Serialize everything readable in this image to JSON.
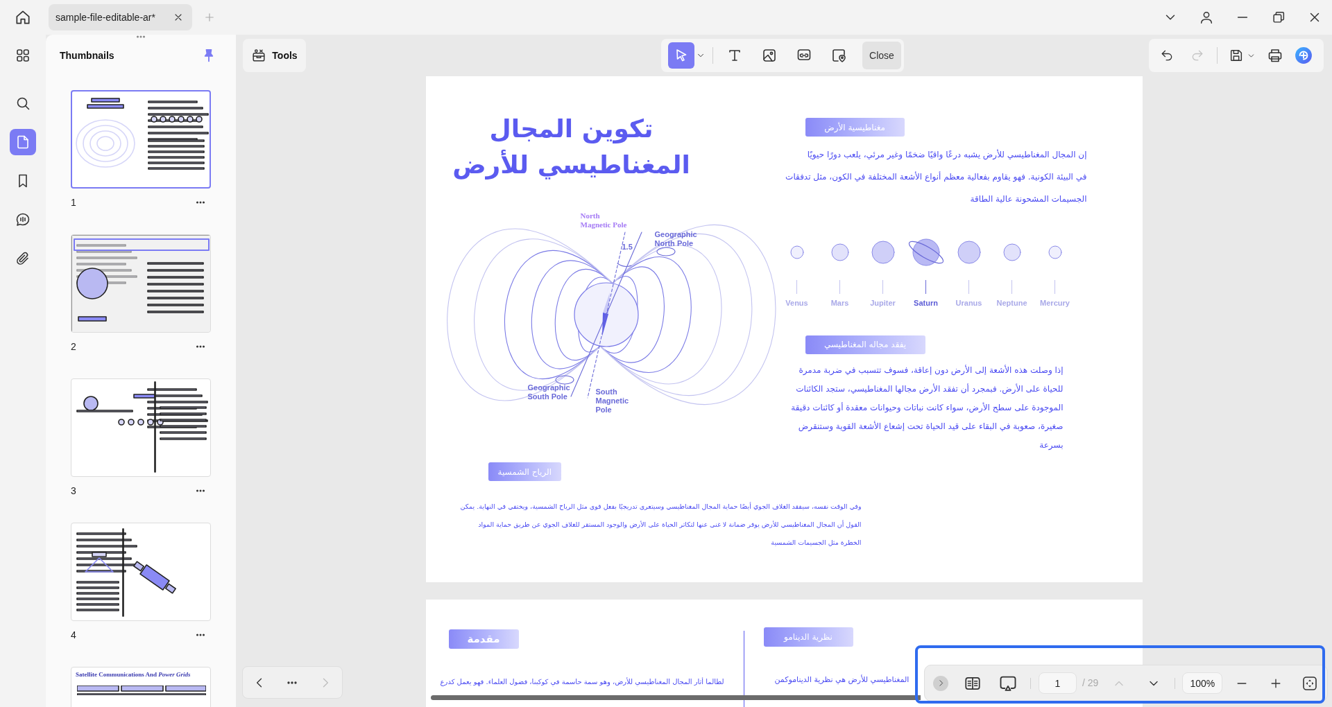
{
  "tabs": [
    {
      "label": "sample-file-editable-ar*",
      "selected": true
    }
  ],
  "rail": [
    {
      "kind": "apps",
      "selected": false
    },
    {
      "kind": "search",
      "selected": false
    },
    {
      "kind": "pages",
      "selected": true
    },
    {
      "kind": "bookmarks",
      "selected": false
    },
    {
      "kind": "comments",
      "selected": false
    },
    {
      "kind": "attachments",
      "selected": false
    }
  ],
  "thumbnails_panel": {
    "title": "Thumbnails",
    "pinned": true,
    "items": [
      {
        "page": "1",
        "selected": true
      },
      {
        "page": "2",
        "selected": false
      },
      {
        "page": "3",
        "selected": false
      },
      {
        "page": "4",
        "selected": false
      },
      {
        "heading": "Satellite Communications And *Power Grids*",
        "selected": false
      }
    ]
  },
  "tools_button": {
    "label": "Tools"
  },
  "edit_toolbar": {
    "tools": [
      {
        "kind": "select",
        "selected": true
      },
      {
        "kind": "text",
        "selected": false
      },
      {
        "kind": "image",
        "selected": false
      },
      {
        "kind": "link",
        "selected": false
      },
      {
        "kind": "stamp",
        "selected": false
      }
    ],
    "close_label": "Close"
  },
  "history": {
    "undo_disabled": false,
    "redo_disabled": true
  },
  "page_1": {
    "title_lines": [
      "تكوين المجال",
      "المغناطيسي للأرض"
    ],
    "sections": [
      {
        "heading": "مغناطيسية الأرض",
        "lines": [
          "إن المجال المغناطيسي للأرض يشبه درعًا واقيًا ضخمًا وغير مرئي، يلعب دورًا حيويًا",
          "في البيئة الكونية. فهو يقاوم بفعالية معظم أنواع الأشعة المختلفة في الكون، مثل تدفقات",
          "الجسيمات المشحونة عالية الطاقة"
        ]
      },
      {
        "heading": "يفقد مجاله المغناطيسي",
        "lines": [
          "إذا وصلت هذه الأشعة إلى الأرض دون إعاقة، فسوف تتسبب في ضربة مدمرة",
          "للحياة على الأرض. فبمجرد أن تفقد الأرض مجالها المغناطيسي، ستجد الكائنات",
          "الموجودة على سطح الأرض، سواء كانت نباتات وحيوانات معقدة أو كائنات دقيقة",
          "صغيرة، صعوبة في البقاء على قيد الحياة تحت إشعاع الأشعة القوية وستنقرض",
          "بسرعة"
        ]
      },
      {
        "heading": "الرياح الشمسية",
        "lines": [
          "وفي الوقت نفسه، سيفقد الغلاف الجوي أيضًا حماية المجال المغناطيسي وسيتعرى تدريجيًا بفعل قوى مثل الرياح الشمسية، ويختفي في النهاية. يمكن",
          "القول أن المجال المغناطيسي للأرض يوفر ضمانة لا غنى عنها لتكاثر الحياة على الأرض والوجود المستقر للغلاف الجوي عن طريق حماية المواد",
          "الخطرة مثل الجسيمات الشمسية"
        ]
      }
    ],
    "diagram_labels": [
      {
        "lines": [
          "North",
          "Magnetic Pole"
        ]
      },
      {
        "lines": [
          "Geographic",
          "North Pole"
        ]
      },
      {
        "lines": [
          "1.5"
        ]
      },
      {
        "lines": [
          "Geographic",
          "South Pole"
        ]
      },
      {
        "lines": [
          "South",
          "Magnetic",
          "Pole"
        ]
      }
    ],
    "planets": [
      {
        "name": "Mercury",
        "kind": "plain"
      },
      {
        "name": "Neptune",
        "kind": "plain"
      },
      {
        "name": "Uranus",
        "kind": "plain"
      },
      {
        "name": "Saturn",
        "kind": "ringed"
      },
      {
        "name": "Jupiter",
        "kind": "plain"
      },
      {
        "name": "Mars",
        "kind": "plain"
      },
      {
        "name": "Venus",
        "kind": "plain"
      }
    ]
  },
  "page_2": {
    "sections": [
      {
        "heading": "نظرية الدينامو",
        "lines": [
          "المغناطيسي للأرض هي نظرية الديناموكمن"
        ]
      },
      {
        "heading": "مقدمة",
        "lines": [
          "لطالما أثار المجال المغناطيسي للأرض، وهو سمة حاسمة في كوكبنا، فضول العلماء. فهو يعمل كدرع"
        ]
      }
    ]
  },
  "page_nav": {
    "previous_disabled": false,
    "next_disabled": true
  },
  "page_controls": {
    "page": "1",
    "total": "/ 29",
    "previous_disabled": true,
    "next_disabled": false,
    "zoom": "100%"
  }
}
